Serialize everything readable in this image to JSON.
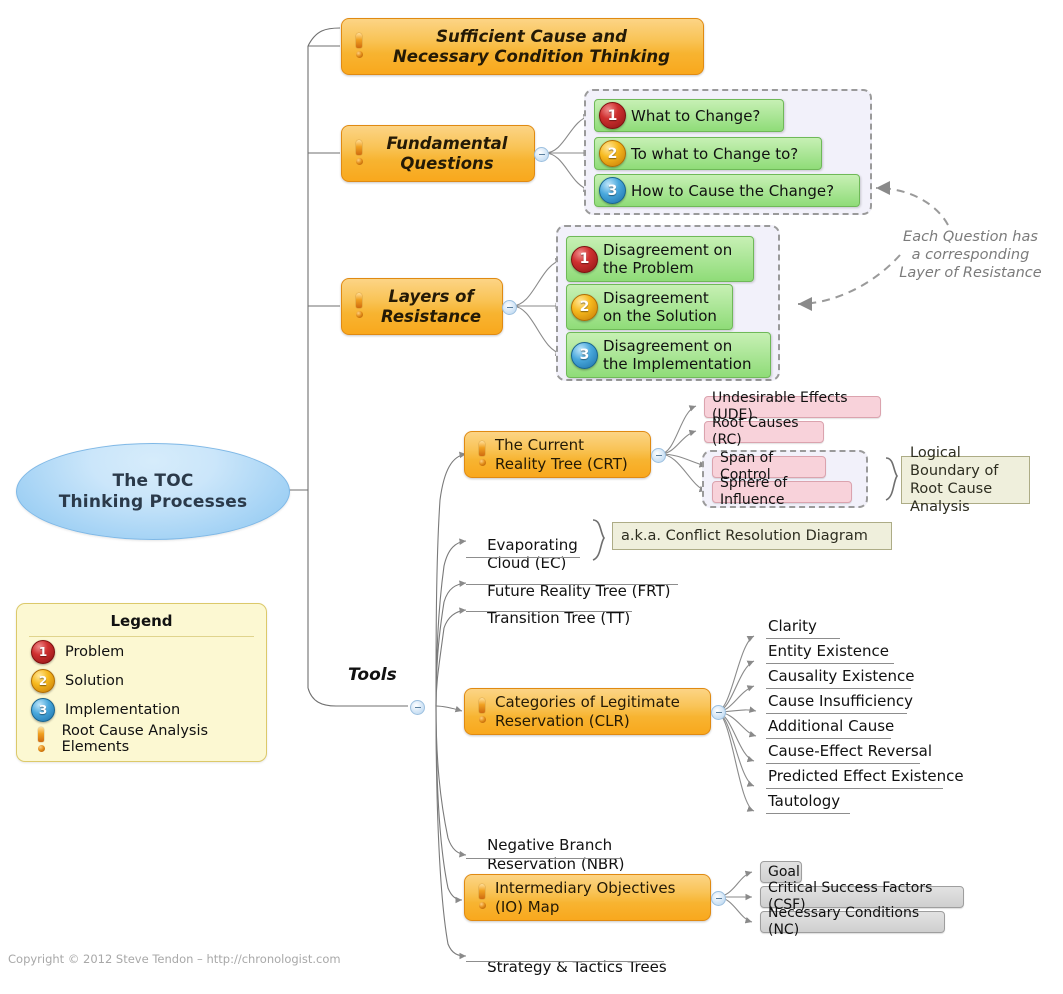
{
  "center": {
    "line1": "The TOC",
    "line2": "Thinking Processes"
  },
  "branches": {
    "sufficient_cause": {
      "line1": "Sufficient Cause and",
      "line2": "Necessary Condition Thinking"
    },
    "fundamental_questions": {
      "line1": "Fundamental",
      "line2": "Questions"
    },
    "layers_of_resistance": {
      "line1": "Layers of",
      "line2": "Resistance"
    },
    "tools": {
      "label": "Tools"
    }
  },
  "fundamental_questions": [
    {
      "num": "1",
      "label": "What to Change?",
      "type": "problem"
    },
    {
      "num": "2",
      "label": "To what to Change to?",
      "type": "solution"
    },
    {
      "num": "3",
      "label": "How to Cause the Change?",
      "type": "implementation"
    }
  ],
  "layers_of_resistance": [
    {
      "num": "1",
      "line1": "Disagreement on",
      "line2": "the Problem",
      "type": "problem"
    },
    {
      "num": "2",
      "line1": "Disagreement",
      "line2": "on the Solution",
      "type": "solution"
    },
    {
      "num": "3",
      "line1": "Disagreement on",
      "line2": "the Implementation",
      "type": "implementation"
    }
  ],
  "annotation": {
    "line1": "Each Question has",
    "line2": "a corresponding",
    "line3": "Layer of Resistance"
  },
  "crt": {
    "title_line1": "The Current",
    "title_line2": "Reality Tree (CRT)",
    "children": [
      {
        "label": "Undesirable Effects (UDE)"
      },
      {
        "label": "Root Causes (RC)"
      },
      {
        "label": "Span of Control"
      },
      {
        "label": "Sphere of Influence"
      }
    ],
    "note_line1": "Logical Boundary of",
    "note_line2": "Root Cause Analysis"
  },
  "evaporating_cloud": {
    "line1": "Evaporating",
    "line2": "Cloud (EC)",
    "note": "a.k.a. Conflict Resolution Diagram"
  },
  "tools_leaves": {
    "frt": "Future Reality Tree (FRT)",
    "tt": "Transition Tree (TT)",
    "nbr_line1": "Negative Branch",
    "nbr_line2": "Reservation (NBR)",
    "stt": "Strategy & Tactics Trees"
  },
  "clr": {
    "title_line1": "Categories of Legitimate",
    "title_line2": "Reservation (CLR)",
    "items": [
      "Clarity",
      "Entity Existence",
      "Causality Existence",
      "Cause Insufficiency",
      "Additional Cause",
      "Cause-Effect Reversal",
      "Predicted Effect Existence",
      "Tautology"
    ]
  },
  "io_map": {
    "title_line1": "Intermediary Objectives",
    "title_line2": "(IO) Map",
    "children": [
      "Goal",
      "Critical Success Factors (CSF)",
      "Necessary Conditions (NC)"
    ]
  },
  "legend": {
    "title": "Legend",
    "items": [
      {
        "icon": "badge-1-icon",
        "label": "Problem"
      },
      {
        "icon": "badge-2-icon",
        "label": "Solution"
      },
      {
        "icon": "badge-3-icon",
        "label": "Implementation"
      },
      {
        "icon": "exclamation-icon",
        "label": "Root Cause Analysis Elements"
      }
    ]
  },
  "footer": {
    "text": "Copyright © 2012 Steve Tendon – http://chronologist.com"
  },
  "colors": {
    "center_fill": "#9fd0f4",
    "branch_orange": "#f7b431",
    "green_box": "#aee79a",
    "pink_box": "#f8d2da",
    "gray_box": "#cfcfcf",
    "note_olive": "#efefdc",
    "legend_yellow": "#fcf8d2",
    "dashed_border": "#9a9a9a",
    "badge_problem": "#cf3030",
    "badge_solution": "#f6b91e",
    "badge_implementation": "#49a8dc"
  }
}
